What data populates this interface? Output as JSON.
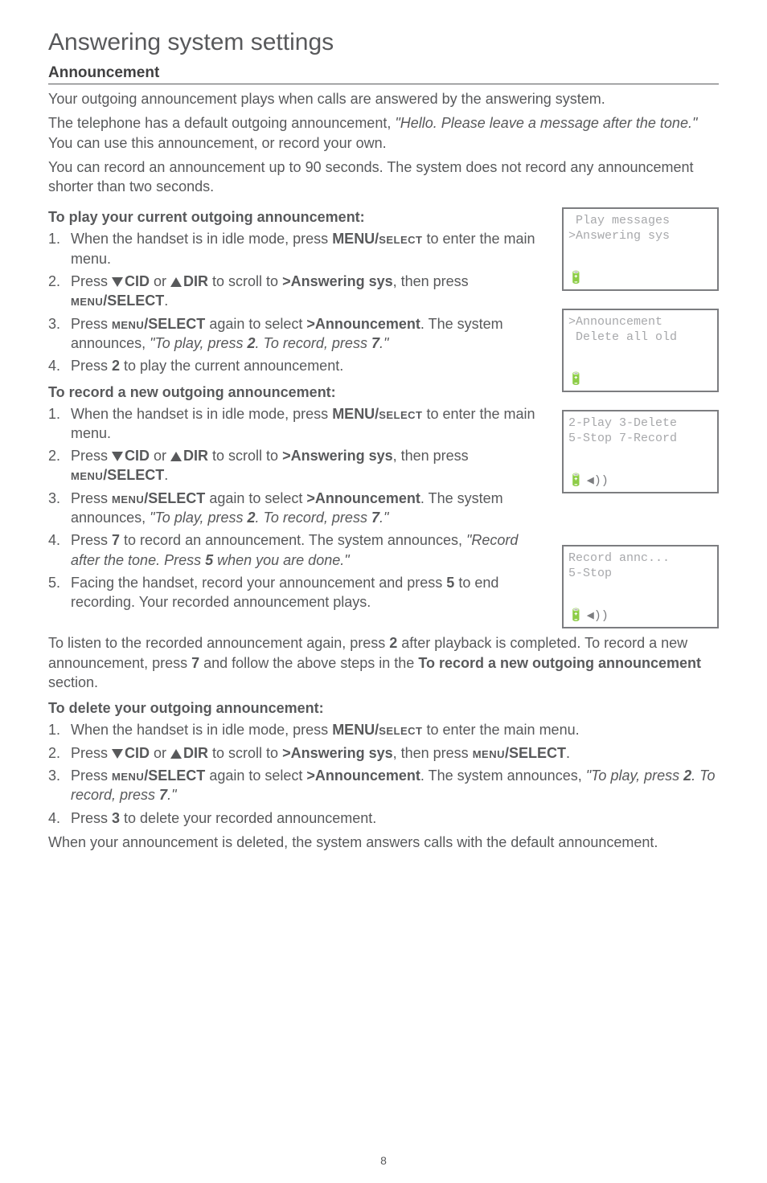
{
  "title": "Answering system settings",
  "section_heading": "Announcement",
  "intro_paras": [
    {
      "plain": "Your outgoing announcement plays when calls are answered by the answering system."
    },
    {
      "plain_before": "The telephone has a default outgoing announcement, ",
      "italic": "\"Hello. Please leave a message after the tone.\"",
      "plain_after": " You can use this announcement, or record your own."
    },
    {
      "plain": "You can record an announcement up to 90 seconds. The system does not record any announcement shorter than two seconds."
    }
  ],
  "play_heading": "To play your current outgoing announcement:",
  "play_steps": {
    "s1a": "When the handset is in idle mode, press ",
    "s1b": "MENU/",
    "s1c": "select",
    "s1d": " to enter the main menu.",
    "s2a": "Press ",
    "s2cid": "CID",
    "s2or": " or ",
    "s2dir": "DIR",
    "s2b": " to scroll to ",
    "s2ans": ">Answering sys",
    "s2c": ", then press ",
    "s2menu": "menu",
    "s2sel": "/SELECT",
    "s2d": ".",
    "s3a": "Press ",
    "s3menu": "menu",
    "s3sel": "/SELECT",
    "s3b": " again to select ",
    "s3ann": ">Announcement",
    "s3c": ". The system announces, ",
    "s3q": "\"To play, press ",
    "s3n2": "2",
    "s3mid": ". To record, press ",
    "s3n7": "7",
    "s3end": ".\"",
    "s4a": "Press ",
    "s4n2": "2",
    "s4b": " to play the current announcement."
  },
  "record_heading": "To record a new outgoing announcement:",
  "record_steps": {
    "s1a": "When the handset is in idle mode, press ",
    "s1b": "MENU/",
    "s1c": "select",
    "s1d": " to enter the main menu.",
    "s2a": "Press ",
    "s2cid": "CID",
    "s2or": " or ",
    "s2dir": "DIR",
    "s2b": " to scroll to ",
    "s2ans": ">Answering sys",
    "s2c": ", then press ",
    "s2menu": "menu",
    "s2sel": "/SELECT",
    "s2d": ".",
    "s3a": "Press ",
    "s3menu": "menu",
    "s3sel": "/SELECT",
    "s3b": " again to select ",
    "s3ann": ">Announcement",
    "s3c": ". The system announces, ",
    "s3q": "\"To play, press ",
    "s3n2": "2",
    "s3mid": ". To record, press ",
    "s3n7": "7",
    "s3end": ".\"",
    "s4a": "Press ",
    "s4n7": "7",
    "s4b": " to record an announcement. The system announces, ",
    "s4q": "\"Record after the tone. Press ",
    "s4n5": "5",
    "s4end": " when you are done.\"",
    "s5a": "Facing the handset, record your announcement and press ",
    "s5n5": "5",
    "s5b": " to end recording. Your recorded announcement plays."
  },
  "listen_para": {
    "a": "To listen to the recorded announcement again, press ",
    "b2": "2",
    "b": " after playback is completed. To record a new announcement, press ",
    "b7": "7",
    "c": " and follow the above steps in the ",
    "bold": "To record a new outgoing announcement",
    "d": " section."
  },
  "delete_heading": "To delete your outgoing announcement:",
  "delete_steps": {
    "s1a": "When the handset is in idle mode, press ",
    "s1b": "MENU/",
    "s1c": "select",
    "s1d": " to enter the main menu.",
    "s2a": "Press ",
    "s2cid": "CID",
    "s2or": " or ",
    "s2dir": "DIR",
    "s2b": " to scroll to ",
    "s2ans": ">Answering sys",
    "s2c": ", then press ",
    "s2menu": "menu",
    "s2sel": "/SELECT",
    "s2d": ".",
    "s3a": "Press ",
    "s3menu": "menu",
    "s3sel": "/SELECT",
    "s3b": " again to select ",
    "s3ann": ">Announcement",
    "s3c": ". The system announces, ",
    "s3q": "\"To play, press ",
    "s3n2": "2",
    "s3mid": ". To record, press ",
    "s3n7": "7",
    "s3end": ".\"",
    "s4a": "Press ",
    "s4n3": "3",
    "s4b": " to delete your recorded announcement."
  },
  "final_para": "When your announcement is deleted, the system answers calls with the default announcement.",
  "page_number": "8",
  "lcd": {
    "screen1": {
      "line1": " Play messages",
      "line2": ">Answering sys",
      "battery": "🔋"
    },
    "screen2": {
      "line1": ">Announcement",
      "line2": " Delete all old",
      "battery": "🔋"
    },
    "screen3": {
      "line1": "2-Play 3-Delete",
      "line2": "5-Stop 7-Record",
      "battery": "🔋",
      "speaker": "◀))"
    },
    "screen4": {
      "line1": "Record annc...",
      "line2": "5-Stop",
      "battery": "🔋",
      "speaker": "◀))"
    }
  }
}
